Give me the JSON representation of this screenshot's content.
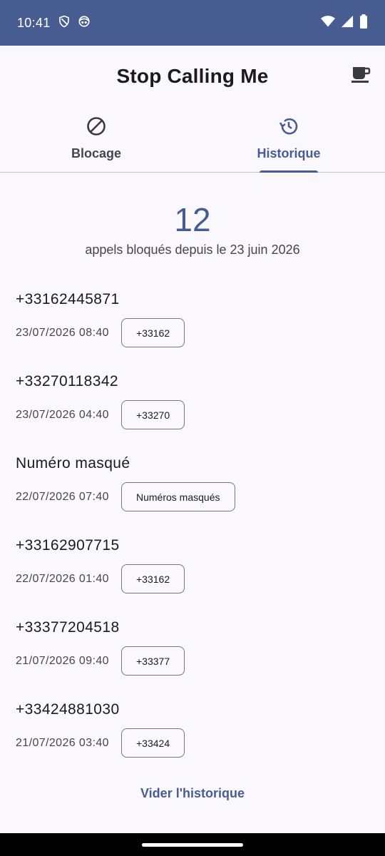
{
  "status_bar": {
    "time": "10:41",
    "icons": [
      "shield-icon",
      "face-icon",
      "wifi-icon",
      "signal-icon",
      "battery-icon"
    ]
  },
  "header": {
    "title": "Stop Calling Me",
    "action_icon": "coffee-icon"
  },
  "tabs": [
    {
      "label": "Blocage",
      "icon": "block-icon",
      "active": false
    },
    {
      "label": "Historique",
      "icon": "history-icon",
      "active": true
    }
  ],
  "summary": {
    "count": "12",
    "since": "appels bloqués depuis le 23 juin 2026"
  },
  "history": [
    {
      "number": "+33162445871",
      "date": "23/07/2026 08:40",
      "chip": "+33162"
    },
    {
      "number": "+33270118342",
      "date": "23/07/2026 04:40",
      "chip": "+33270"
    },
    {
      "number": "Numéro masqué",
      "date": "22/07/2026 07:40",
      "chip": "Numéros masqués"
    },
    {
      "number": "+33162907715",
      "date": "22/07/2026 01:40",
      "chip": "+33162"
    },
    {
      "number": "+33377204518",
      "date": "21/07/2026 09:40",
      "chip": "+33377"
    },
    {
      "number": "+33424881030",
      "date": "21/07/2026 03:40",
      "chip": "+33424"
    }
  ],
  "clear_label": "Vider l'historique",
  "colors": {
    "primary": "#475d92",
    "status_bar": "#475d92",
    "background": "#fbf8fd"
  }
}
